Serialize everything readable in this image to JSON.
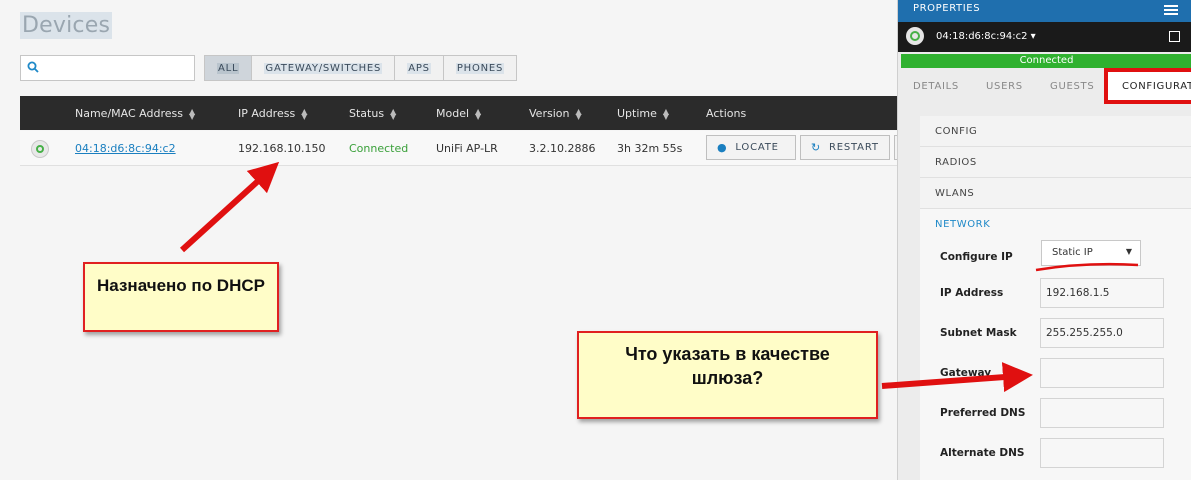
{
  "page": {
    "title": "Devices"
  },
  "search": {
    "placeholder": "",
    "value": ""
  },
  "filters": [
    {
      "label": "ALL",
      "active": true
    },
    {
      "label": "GATEWAY/SWITCHES",
      "active": false
    },
    {
      "label": "APS",
      "active": false
    },
    {
      "label": "PHONES",
      "active": false
    }
  ],
  "table": {
    "columns": [
      "Name/MAC Address",
      "IP Address",
      "Status",
      "Model",
      "Version",
      "Uptime",
      "Actions"
    ],
    "rows": [
      {
        "mac": "04:18:d6:8c:94:c2",
        "ip": "192.168.10.150",
        "status": "Connected",
        "model": "UniFi AP-LR",
        "version": "3.2.10.2886",
        "uptime": "3h 32m 55s",
        "actions": [
          "LOCATE",
          "RESTART"
        ]
      }
    ]
  },
  "panel": {
    "header": "PROPERTIES",
    "device": "04:18:d6:8c:94:c2",
    "connection_status": "Connected",
    "tabs": [
      "DETAILS",
      "USERS",
      "GUESTS",
      "CONFIGURATIO"
    ],
    "sections": [
      "CONFIG",
      "RADIOS",
      "WLANS",
      "NETWORK"
    ],
    "network": {
      "configure_ip_label": "Configure IP",
      "configure_ip_value": "Static IP",
      "ip_label": "IP Address",
      "ip_value": "192.168.1.5",
      "mask_label": "Subnet Mask",
      "mask_value": "255.255.255.0",
      "gateway_label": "Gateway",
      "gateway_value": "",
      "dns1_label": "Preferred DNS",
      "dns1_value": "",
      "dns2_label": "Alternate DNS",
      "dns2_value": ""
    }
  },
  "annotations": {
    "note1": "Назначено по DHCP",
    "note2": "Что указать в качестве шлюза?"
  },
  "colors": {
    "accent": "#1f6fae",
    "connected": "#2fb12f",
    "annotation": "#e02020"
  },
  "icons": [
    "search-icon",
    "sort-icon",
    "locate-icon",
    "restart-icon",
    "menu-icon",
    "popout-icon",
    "dropdown-caret-icon"
  ]
}
